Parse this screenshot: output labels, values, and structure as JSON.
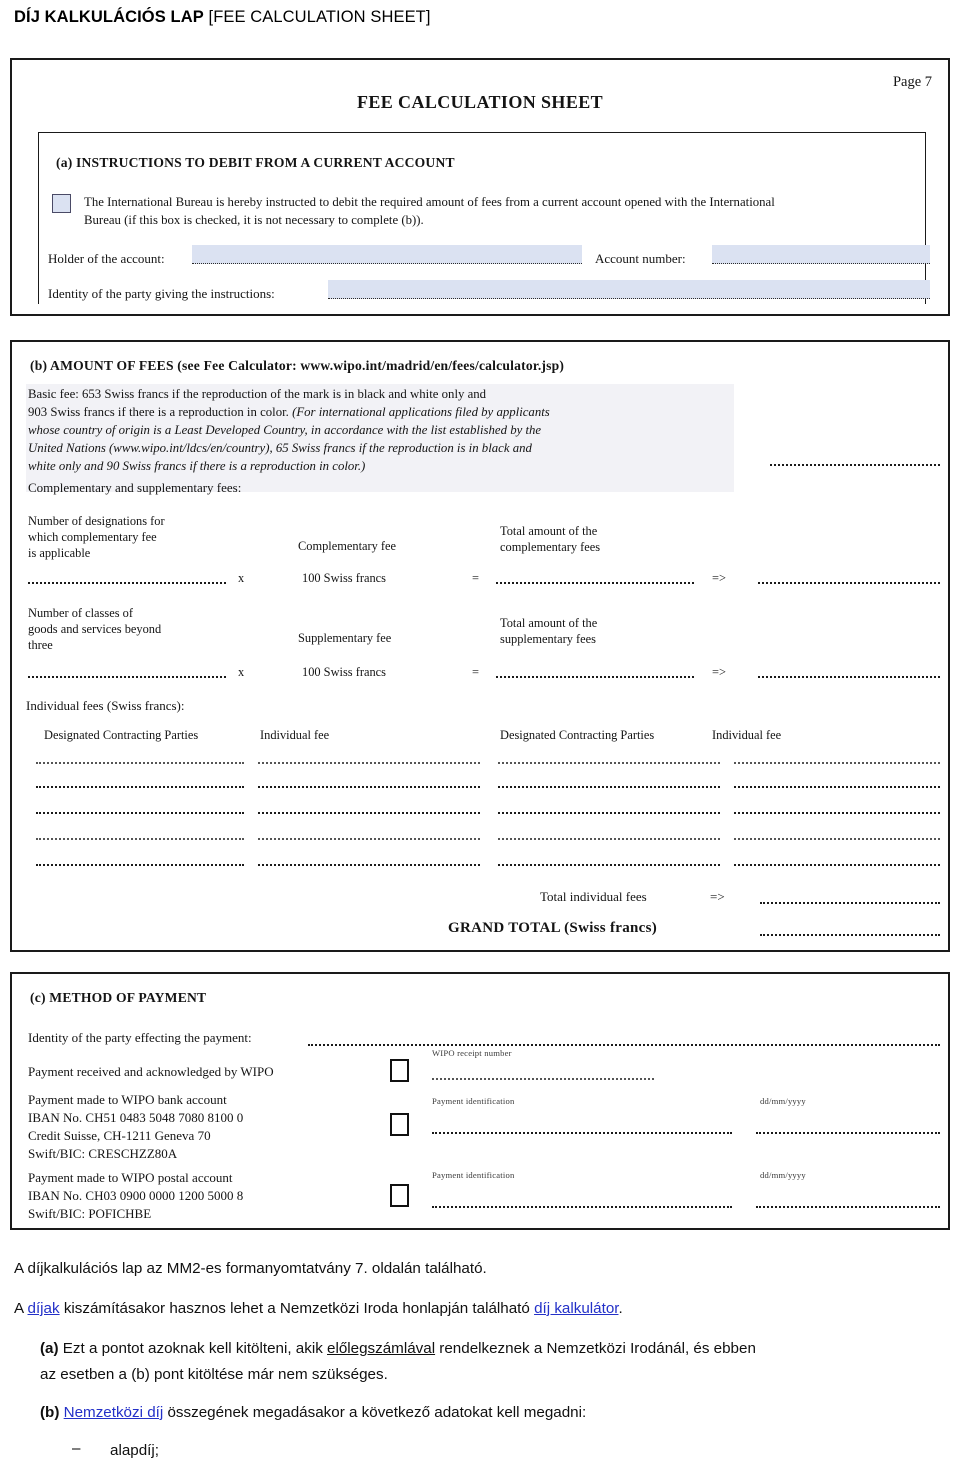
{
  "document": {
    "title_bold": "DÍJ KALKULÁCIÓS LAP",
    "title_plain": " [FEE CALCULATION SHEET]"
  },
  "form": {
    "page_number": "Page 7",
    "sheet_title": "FEE CALCULATION SHEET",
    "section_a": {
      "heading": "(a) INSTRUCTIONS TO DEBIT FROM A CURRENT ACCOUNT",
      "checkbox_text_line1": "The International Bureau is hereby instructed to debit the required amount of fees from a current account opened with the International",
      "checkbox_text_line2": "Bureau (if this box is checked, it is not necessary to complete (b)).",
      "holder_label": "Holder of the account:",
      "account_number_label": "Account number:",
      "identity_label": "Identity of the party giving the instructions:",
      "holder_value": "",
      "account_number_value": "",
      "identity_value": ""
    },
    "section_b": {
      "heading": "(b) AMOUNT OF FEES (see Fee Calculator:  www.wipo.int/madrid/en/fees/calculator.jsp)",
      "basic_fee_line1": "Basic fee: 653  Swiss  francs  if  the  reproduction  of  the  mark  is  in  black  and  white  only  and",
      "basic_fee_line2": "903 Swiss francs if there is a reproduction in color.  ",
      "basic_fee_italic1": "(For  international  applications  filed  by  applicants",
      "basic_fee_italic2": "whose country of origin is a Least Developed Country, in accordance with the list established by the",
      "basic_fee_italic3": "United Nations (www.wipo.int/ldcs/en/country),  65 Swiss  francs  if  the  reproduction  is  in  black  and",
      "basic_fee_italic4": "white only and 90 Swiss francs if there is a reproduction in color.)",
      "comp_supp_heading": "Complementary and supplementary fees:",
      "complementary": {
        "count_label_l1": "Number of designations for",
        "count_label_l2": "which complementary fee",
        "count_label_l3": "is applicable",
        "fee_label": "Complementary fee",
        "total_label_l1": "Total amount of the",
        "total_label_l2": "complementary fees",
        "multiply": "x",
        "fee_amount": "100 Swiss francs",
        "equals": "=",
        "arrow": "=>"
      },
      "supplementary": {
        "count_label_l1": "Number of classes of",
        "count_label_l2": "goods and services beyond",
        "count_label_l3": "three",
        "fee_label": "Supplementary fee",
        "total_label_l1": "Total amount of the",
        "total_label_l2": "supplementary fees",
        "multiply": "x",
        "fee_amount": "100 Swiss francs",
        "equals": "=",
        "arrow": "=>"
      },
      "individual_fees_heading": "Individual fees (Swiss francs):",
      "individual_columns": [
        "Designated Contracting Parties",
        "Individual fee",
        "Designated Contracting Parties",
        "Individual fee"
      ],
      "individual_rows": 5,
      "total_individual_label": "Total individual fees",
      "total_individual_arrow": "=>",
      "grand_total_label": "GRAND TOTAL (Swiss francs)"
    },
    "section_c": {
      "heading": "(c) METHOD OF PAYMENT",
      "identity_label": "Identity of the party effecting the payment:",
      "row1": {
        "label": "Payment received and acknowledged by WIPO",
        "small_label": "WIPO receipt number"
      },
      "row2": {
        "label_l1": "Payment made to WIPO bank account",
        "label_l2": "IBAN No. CH51 0483 5048 7080 8100 0",
        "label_l3": "Credit Suisse, CH-1211 Geneva 70",
        "label_l4": "Swift/BIC:  CRESCHZZ80A",
        "small_label": "Payment identification",
        "date_label": "dd/mm/yyyy"
      },
      "row3": {
        "label_l1": "Payment made to WIPO postal account",
        "label_l2": "IBAN No. CH03 0900 0000 1200 5000 8",
        "label_l3": "Swift/BIC:  POFICHBE",
        "small_label": "Payment identification",
        "date_label": "dd/mm/yyyy"
      }
    }
  },
  "notes": {
    "line1": "A díjkalkulációs lap az MM2-es formanyomtatvány 7. oldalán található.",
    "line2_a": "A ",
    "line2_link1": "díjak",
    "line2_b": " kiszámításakor hasznos lehet a Nemzetközi Iroda honlapján található ",
    "line2_link2": "díj kalkulátor",
    "line2_c": ".",
    "item_a_marker": "(a)",
    "item_a_t1": " Ezt a pontot azoknak kell kitölteni, akik ",
    "item_a_u": "előlegszámlával",
    "item_a_t2": " rendelkeznek a Nemzetközi Irodánál, és ebben",
    "item_a_line2": "az esetben a (b) pont kitöltése már nem szükséges.",
    "item_b_marker": "(b)",
    "item_b_link": "Nemzetközi díj",
    "item_b_text": " összegének megadásakor a következő adatokat kell megadni:",
    "bullet_dash": "–",
    "bullet_1": "alapdíj;"
  },
  "colors": {
    "link": "#2330c8",
    "field_fill": "#dbe2f2",
    "ink": "#141414"
  }
}
